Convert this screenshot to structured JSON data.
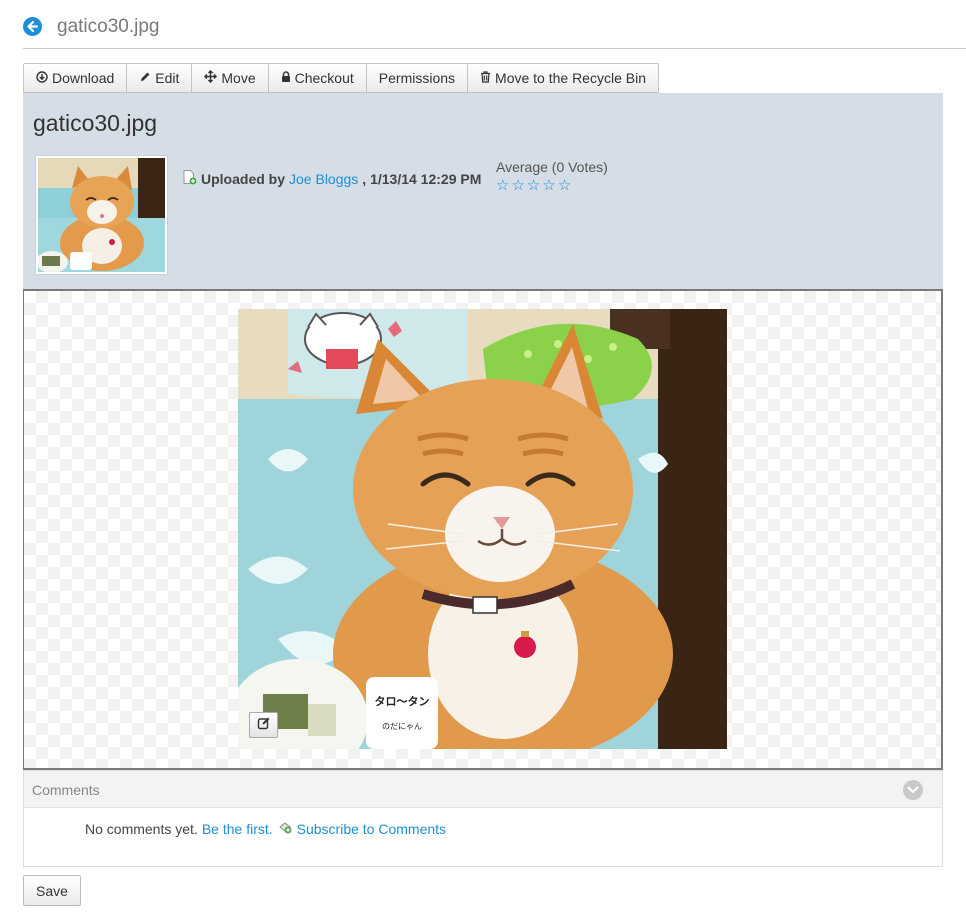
{
  "header": {
    "title": "gatico30.jpg"
  },
  "toolbar": {
    "download": "Download",
    "edit": "Edit",
    "move": "Move",
    "checkout": "Checkout",
    "permissions": "Permissions",
    "recycle": "Move to the Recycle Bin"
  },
  "document": {
    "title": "gatico30.jpg",
    "uploaded_by_label": "Uploaded by",
    "uploader": "Joe Bloggs",
    "upload_date": ", 1/13/14 12:29 PM",
    "rating_label": "Average (0 Votes)",
    "stars": [
      "☆",
      "☆",
      "☆",
      "☆",
      "☆"
    ]
  },
  "comments": {
    "title": "Comments",
    "empty_text": "No comments yet.",
    "be_first": "Be the first.",
    "subscribe": "Subscribe to Comments"
  },
  "form": {
    "save_label": "Save"
  },
  "image_sticker": {
    "line1": "タロ〜タン",
    "line2": "のだにゃん"
  },
  "colors": {
    "link": "#1e8fd6",
    "panel": "#d5dde6"
  },
  "icons": [
    "back-arrow-icon",
    "download-icon",
    "pencil-icon",
    "move-icon",
    "lock-icon",
    "trash-icon",
    "document-add-icon",
    "star-icon",
    "edit-icon",
    "subscribe-icon",
    "chevron-down-icon"
  ]
}
